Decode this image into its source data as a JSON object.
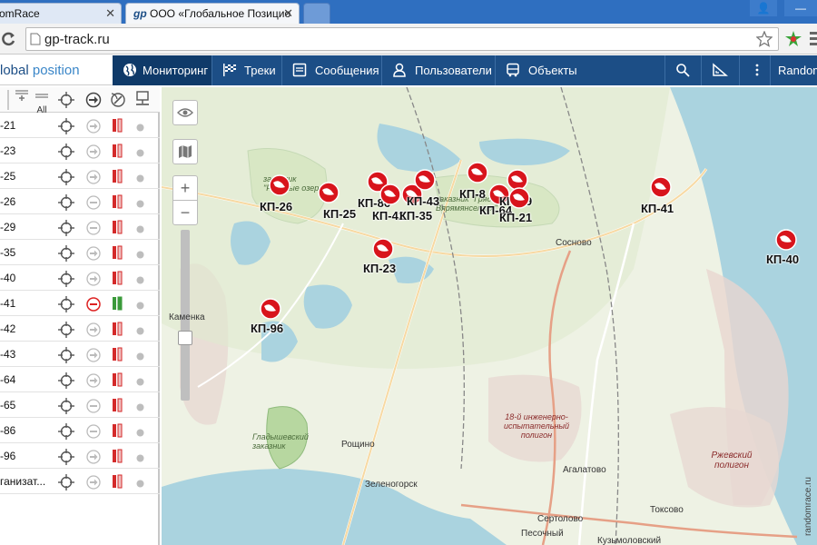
{
  "browser": {
    "tabs": [
      {
        "title": "omRace"
      },
      {
        "title": "ООО «Глобальное Позицио"
      }
    ],
    "url": "gp-track.ru"
  },
  "app": {
    "brand_part1": "lobal",
    "brand_part2": "position",
    "nav": [
      {
        "label": "Мониторинг",
        "icon": "globe-icon",
        "active": true
      },
      {
        "label": "Треки",
        "icon": "checkered-flag-icon"
      },
      {
        "label": "Сообщения",
        "icon": "messages-icon"
      },
      {
        "label": "Пользователи",
        "icon": "user-icon"
      },
      {
        "label": "Объекты",
        "icon": "bus-icon"
      }
    ],
    "right_label": "Random"
  },
  "panel": {
    "header": {
      "add_all": "All"
    },
    "rows": [
      {
        "label": "-21",
        "status": "gray",
        "nav": "arrow"
      },
      {
        "label": "-23",
        "status": "gray",
        "nav": "arrow"
      },
      {
        "label": "-25",
        "status": "gray",
        "nav": "arrow"
      },
      {
        "label": "-26",
        "status": "gray",
        "nav": "minus"
      },
      {
        "label": "-29",
        "status": "gray",
        "nav": "minus"
      },
      {
        "label": "-35",
        "status": "gray",
        "nav": "arrow"
      },
      {
        "label": "-40",
        "status": "gray",
        "nav": "arrow"
      },
      {
        "label": "-41",
        "status": "green",
        "nav": "minus-red"
      },
      {
        "label": "-42",
        "status": "gray",
        "nav": "arrow"
      },
      {
        "label": "-43",
        "status": "gray",
        "nav": "arrow"
      },
      {
        "label": "-64",
        "status": "gray",
        "nav": "arrow"
      },
      {
        "label": "-65",
        "status": "gray",
        "nav": "minus"
      },
      {
        "label": "-86",
        "status": "gray",
        "nav": "minus"
      },
      {
        "label": "-96",
        "status": "gray",
        "nav": "arrow"
      },
      {
        "label": "ганизат...",
        "status": "gray",
        "nav": "arrow"
      }
    ]
  },
  "map": {
    "places": [
      {
        "name": "Каменка"
      },
      {
        "name": "Сосново"
      },
      {
        "name": "Рощино"
      },
      {
        "name": "Зеленогорск"
      },
      {
        "name": "Агалатово"
      },
      {
        "name": "Токсово"
      },
      {
        "name": "Сертолово"
      },
      {
        "name": "Песочный"
      },
      {
        "name": "Кузьмоловский"
      }
    ],
    "reserves": [
      {
        "name": "заказник \"Раковые озера\""
      },
      {
        "name": "заказник \"Гряда Вярямянселькя\""
      },
      {
        "name": "Гладышевский заказник"
      }
    ],
    "polygons": [
      {
        "name": "18-й инженерно-испытательный полигон"
      },
      {
        "name": "Ржевский полигон"
      }
    ],
    "markers": [
      {
        "label": "КП-26"
      },
      {
        "label": "КП-25"
      },
      {
        "label": "КП-86"
      },
      {
        "label": "КП-42"
      },
      {
        "label": "КП-35"
      },
      {
        "label": "КП-43"
      },
      {
        "label": "КП-8"
      },
      {
        "label": "КП-64"
      },
      {
        "label": "КП-29"
      },
      {
        "label": "КП-21"
      },
      {
        "label": "КП-41"
      },
      {
        "label": "КП-40"
      },
      {
        "label": "КП-23"
      },
      {
        "label": "КП-96"
      }
    ],
    "watermark": "randomrace.ru"
  }
}
